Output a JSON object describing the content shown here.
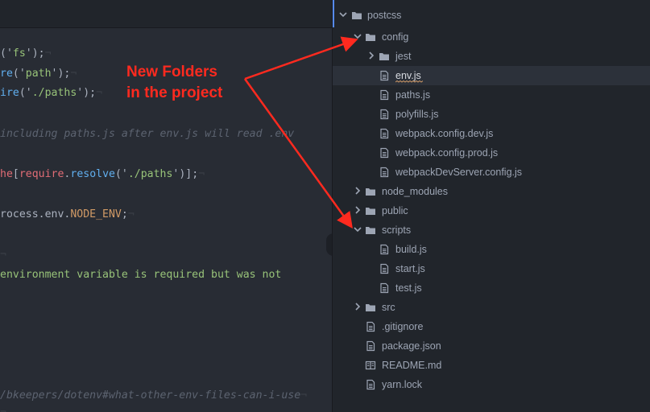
{
  "editor": {
    "lines": [
      {
        "parts": [
          {
            "t": "('",
            "c": ""
          },
          {
            "t": "fs",
            "c": "s"
          },
          {
            "t": "');",
            "c": ""
          },
          {
            "t": "¬",
            "c": "inv"
          }
        ]
      },
      {
        "parts": [
          {
            "t": "re",
            "c": "f"
          },
          {
            "t": "('",
            "c": ""
          },
          {
            "t": "path",
            "c": "s"
          },
          {
            "t": "');",
            "c": ""
          },
          {
            "t": "¬",
            "c": "inv"
          }
        ]
      },
      {
        "parts": [
          {
            "t": "ire",
            "c": "f"
          },
          {
            "t": "('",
            "c": ""
          },
          {
            "t": "./paths",
            "c": "s"
          },
          {
            "t": "');",
            "c": ""
          },
          {
            "t": "¬",
            "c": "inv"
          }
        ]
      },
      {
        "parts": [
          {
            "t": "including paths.js after env.js will read .env",
            "c": "c"
          }
        ]
      },
      {
        "parts": [
          {
            "t": "he",
            "c": "r"
          },
          {
            "t": "[",
            "c": ""
          },
          {
            "t": "require",
            "c": "r"
          },
          {
            "t": ".",
            "c": ""
          },
          {
            "t": "resolve",
            "c": "f"
          },
          {
            "t": "('",
            "c": ""
          },
          {
            "t": "./paths",
            "c": "s"
          },
          {
            "t": "')];",
            "c": ""
          },
          {
            "t": "¬",
            "c": "inv"
          }
        ]
      },
      {
        "parts": [
          {
            "t": "rocess",
            "c": ""
          },
          {
            "t": ".env.",
            "c": ""
          },
          {
            "t": "NODE_ENV",
            "c": "k"
          },
          {
            "t": ";",
            "c": ""
          },
          {
            "t": "¬",
            "c": "inv"
          }
        ]
      },
      {
        "parts": [
          {
            "t": "¬",
            "c": "inv"
          }
        ]
      },
      {
        "parts": [
          {
            "t": "environment variable is required but was not",
            "c": "s"
          }
        ]
      },
      {
        "parts": [
          {
            "t": "/bkeepers/dotenv#what-other-env-files-can-i-use",
            "c": "c"
          },
          {
            "t": "¬",
            "c": "inv"
          }
        ]
      },
      {
        "parts": [
          {
            "t": "¬",
            "c": "inv"
          }
        ]
      }
    ]
  },
  "tree": {
    "root": "postcss",
    "items": [
      {
        "label": "config",
        "kind": "folder",
        "open": true,
        "depth": 1
      },
      {
        "label": "jest",
        "kind": "folder",
        "open": false,
        "depth": 2
      },
      {
        "label": "env.js",
        "kind": "file",
        "depth": 2,
        "selected": true
      },
      {
        "label": "paths.js",
        "kind": "file",
        "depth": 2
      },
      {
        "label": "polyfills.js",
        "kind": "file",
        "depth": 2
      },
      {
        "label": "webpack.config.dev.js",
        "kind": "file",
        "depth": 2
      },
      {
        "label": "webpack.config.prod.js",
        "kind": "file",
        "depth": 2
      },
      {
        "label": "webpackDevServer.config.js",
        "kind": "file",
        "depth": 2
      },
      {
        "label": "node_modules",
        "kind": "folder",
        "open": false,
        "depth": 1
      },
      {
        "label": "public",
        "kind": "folder",
        "open": false,
        "depth": 1
      },
      {
        "label": "scripts",
        "kind": "folder",
        "open": true,
        "depth": 1
      },
      {
        "label": "build.js",
        "kind": "file",
        "depth": 2
      },
      {
        "label": "start.js",
        "kind": "file",
        "depth": 2
      },
      {
        "label": "test.js",
        "kind": "file",
        "depth": 2
      },
      {
        "label": "src",
        "kind": "folder",
        "open": false,
        "depth": 1
      },
      {
        "label": ".gitignore",
        "kind": "file",
        "depth": 1
      },
      {
        "label": "package.json",
        "kind": "file",
        "depth": 1
      },
      {
        "label": "README.md",
        "kind": "book",
        "depth": 1
      },
      {
        "label": "yarn.lock",
        "kind": "file",
        "depth": 1
      }
    ]
  },
  "annotation": {
    "line1": "New Folders",
    "line2": "in the project",
    "color": "#ff2a1f"
  }
}
